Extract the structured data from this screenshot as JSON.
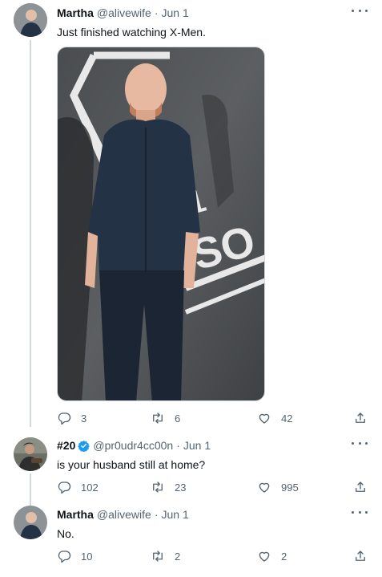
{
  "tweets": [
    {
      "name": "Martha",
      "handle": "@alivewife",
      "sep": "·",
      "date": "Jun 1",
      "text": "Just finished watching X-Men.",
      "replies": "3",
      "retweets": "6",
      "likes": "42"
    },
    {
      "name": "#20",
      "handle": "@pr0udr4cc00n",
      "sep": "·",
      "date": "Jun 1",
      "text": "is your husband still at home?",
      "replies": "102",
      "retweets": "23",
      "likes": "995",
      "verified": true
    },
    {
      "name": "Martha",
      "handle": "@alivewife",
      "sep": "·",
      "date": "Jun 1",
      "text": "No.",
      "replies": "10",
      "retweets": "2",
      "likes": "2"
    }
  ],
  "colors": {
    "text": "#0f1419",
    "secondary": "#536471",
    "verified": "#1d9bf0",
    "thread_line": "#cfd9de"
  },
  "icons": [
    "reply-icon",
    "retweet-icon",
    "like-icon",
    "share-icon",
    "more-icon",
    "verified-icon"
  ]
}
